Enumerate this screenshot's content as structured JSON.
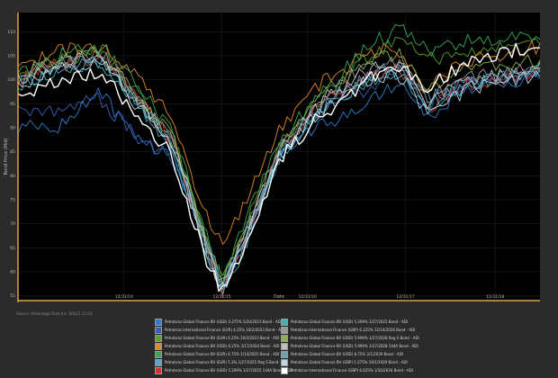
{
  "source": "Source: Advantage Data Inc. 6/4/21 11:53",
  "chart_data": {
    "type": "line",
    "xlabel": "Date",
    "ylabel": "Bond Price (Mid)",
    "x_ticks": [
      "12/31/14",
      "12/31/15",
      "12/31/16",
      "12/31/17",
      "12/31/18"
    ],
    "x_tick_pos": [
      1.3,
      2.5,
      3.55,
      4.75,
      5.85
    ],
    "x_range": [
      0,
      6.4
    ],
    "ylim": [
      54,
      114
    ],
    "y_ticks": [
      55,
      60,
      65,
      70,
      75,
      80,
      85,
      90,
      95,
      100,
      105,
      110
    ],
    "grid": true,
    "legend_placement": "bottom",
    "series": [
      {
        "name": "Petrobras Global Finance BV (USD) 4.375% 5/20/2023 Bond - ADI",
        "color": "#2c7fd0",
        "values": [
          [
            0,
            90
          ],
          [
            0.5,
            90
          ],
          [
            1,
            98
          ],
          [
            1.4,
            88
          ],
          [
            1.9,
            84
          ],
          [
            2.3,
            67
          ],
          [
            2.5,
            57
          ],
          [
            2.8,
            67
          ],
          [
            3.2,
            84
          ],
          [
            3.6,
            90
          ],
          [
            4,
            92
          ],
          [
            4.3,
            96
          ],
          [
            4.7,
            100
          ],
          [
            5,
            92
          ],
          [
            5.5,
            98
          ],
          [
            6.4,
            101
          ]
        ]
      },
      {
        "name": "Petrobras International Finance (EUR) 4.25% 10/2/2023 Bond - ADI",
        "color": "#3a5fb8",
        "values": [
          [
            0,
            93
          ],
          [
            0.5,
            94
          ],
          [
            1,
            96
          ],
          [
            1.4,
            89
          ],
          [
            1.9,
            84
          ],
          [
            2.3,
            68
          ],
          [
            2.5,
            58
          ],
          [
            2.8,
            69
          ],
          [
            3.2,
            85
          ],
          [
            3.6,
            92
          ],
          [
            4,
            95
          ],
          [
            4.3,
            98
          ],
          [
            4.7,
            102
          ],
          [
            5,
            95
          ],
          [
            5.5,
            99
          ],
          [
            6.4,
            102
          ]
        ]
      },
      {
        "name": "Petrobras Global Finance BV (EUR) 4.25% 10/2/2023 Bond - ADI",
        "color": "#5a9f2c",
        "values": [
          [
            0,
            100
          ],
          [
            0.5,
            104
          ],
          [
            1,
            106
          ],
          [
            1.4,
            99
          ],
          [
            1.9,
            88
          ],
          [
            2.3,
            68
          ],
          [
            2.5,
            58
          ],
          [
            2.8,
            70
          ],
          [
            3.2,
            86
          ],
          [
            3.6,
            94
          ],
          [
            4,
            100
          ],
          [
            4.3,
            105
          ],
          [
            4.7,
            108
          ],
          [
            5,
            104
          ],
          [
            5.5,
            106
          ],
          [
            6.4,
            109
          ]
        ]
      },
      {
        "name": "Petrobras Global Finance BV (USD) 6.25% 3/17/2024 Bond - ADI",
        "color": "#e08a1e",
        "values": [
          [
            0,
            102
          ],
          [
            0.5,
            106
          ],
          [
            1,
            107
          ],
          [
            1.4,
            102
          ],
          [
            1.9,
            92
          ],
          [
            2.3,
            72
          ],
          [
            2.5,
            66
          ],
          [
            2.8,
            75
          ],
          [
            3.2,
            90
          ],
          [
            3.6,
            98
          ],
          [
            4,
            102
          ],
          [
            4.3,
            106
          ],
          [
            4.7,
            106
          ],
          [
            5,
            98
          ],
          [
            5.5,
            104
          ],
          [
            6.4,
            107
          ]
        ]
      },
      {
        "name": "Petrobras Global Finance BV (EUR) 4.75% 1/14/2025 Bond - ADI",
        "color": "#37a85a",
        "values": [
          [
            0,
            101
          ],
          [
            0.5,
            105
          ],
          [
            1,
            107
          ],
          [
            1.4,
            100
          ],
          [
            1.9,
            89
          ],
          [
            2.3,
            68
          ],
          [
            2.5,
            58
          ],
          [
            2.8,
            71
          ],
          [
            3.2,
            87
          ],
          [
            3.6,
            95
          ],
          [
            4,
            102
          ],
          [
            4.3,
            107
          ],
          [
            4.7,
            111
          ],
          [
            5,
            106
          ],
          [
            5.5,
            108
          ],
          [
            6.4,
            110
          ]
        ]
      },
      {
        "name": "Petrobras Global Finance BV (EUR) 5.3% 1/27/2025 Reg S Bond - ADI",
        "color": "#5fa0d0",
        "values": [
          [
            0,
            99
          ],
          [
            0.5,
            102
          ],
          [
            1,
            104
          ],
          [
            1.4,
            97
          ],
          [
            1.9,
            87
          ],
          [
            2.3,
            66
          ],
          [
            2.5,
            56
          ],
          [
            2.8,
            67
          ],
          [
            3.2,
            84
          ],
          [
            3.6,
            92
          ],
          [
            4,
            98
          ],
          [
            4.3,
            101
          ],
          [
            4.7,
            103
          ],
          [
            5,
            96
          ],
          [
            5.5,
            99
          ],
          [
            6.4,
            102
          ]
        ]
      },
      {
        "name": "Petrobras Global Finance BV (USD) 5.299% 1/27/2025 144A Bond - ADI",
        "color": "#d83030",
        "values": [
          [
            0,
            100
          ],
          [
            0.5,
            103
          ],
          [
            1,
            105
          ],
          [
            1.4,
            98
          ],
          [
            1.9,
            87
          ],
          [
            2.3,
            66
          ],
          [
            2.5,
            56
          ],
          [
            2.8,
            67
          ],
          [
            3.2,
            85
          ],
          [
            3.6,
            93
          ],
          [
            4,
            98
          ],
          [
            4.3,
            101
          ],
          [
            4.7,
            102
          ],
          [
            5,
            94
          ],
          [
            5.5,
            99
          ],
          [
            6.4,
            102
          ]
        ]
      },
      {
        "name": "Petrobras Global Finance BV (USD) 5.299% 1/27/2025 Bond - ADI",
        "color": "#3ab8b8",
        "values": [
          [
            0,
            99
          ],
          [
            0.5,
            102
          ],
          [
            1,
            104
          ],
          [
            1.4,
            96
          ],
          [
            1.9,
            86
          ],
          [
            2.3,
            65
          ],
          [
            2.5,
            55
          ],
          [
            2.8,
            66
          ],
          [
            3.2,
            84
          ],
          [
            3.6,
            92
          ],
          [
            4,
            97
          ],
          [
            4.3,
            100
          ],
          [
            4.7,
            102
          ],
          [
            5,
            94
          ],
          [
            5.5,
            99
          ],
          [
            6.4,
            102
          ]
        ]
      },
      {
        "name": "Petrobras International Finance (GBP) 6.125% 12/14/2026 Bond - ADI",
        "color": "#9a9a9a",
        "values": [
          [
            0,
            102
          ],
          [
            0.5,
            104
          ],
          [
            1,
            106
          ],
          [
            1.4,
            98
          ],
          [
            1.9,
            87
          ],
          [
            2.3,
            66
          ],
          [
            2.5,
            57
          ],
          [
            2.8,
            68
          ],
          [
            3.2,
            86
          ],
          [
            3.6,
            94
          ],
          [
            4,
            100
          ],
          [
            4.3,
            103
          ],
          [
            4.7,
            104
          ],
          [
            5,
            96
          ],
          [
            5.5,
            100
          ],
          [
            6.4,
            103
          ]
        ]
      },
      {
        "name": "Petrobras Global Finance BV (USD) 5.999% 1/27/2028 Reg S Bond - ADI",
        "color": "#8ab04a",
        "values": [
          [
            0,
            101
          ],
          [
            0.5,
            104
          ],
          [
            1,
            106
          ],
          [
            1.4,
            98
          ],
          [
            1.9,
            88
          ],
          [
            2.3,
            67
          ],
          [
            2.5,
            58
          ],
          [
            2.8,
            69
          ],
          [
            3.2,
            86
          ],
          [
            3.6,
            94
          ],
          [
            4,
            101
          ],
          [
            4.3,
            104
          ],
          [
            4.7,
            105
          ],
          [
            5,
            98
          ],
          [
            5.5,
            102
          ],
          [
            6.4,
            104
          ]
        ]
      },
      {
        "name": "Petrobras Global Finance BV (USD) 5.999% 1/27/2028 144A Bond - ADI",
        "color": "#c0c0c0",
        "values": [
          [
            0,
            100
          ],
          [
            0.5,
            103
          ],
          [
            1,
            105
          ],
          [
            1.4,
            97
          ],
          [
            1.9,
            87
          ],
          [
            2.3,
            66
          ],
          [
            2.5,
            57
          ],
          [
            2.8,
            68
          ],
          [
            3.2,
            85
          ],
          [
            3.6,
            93
          ],
          [
            4,
            99
          ],
          [
            4.3,
            102
          ],
          [
            4.7,
            103
          ],
          [
            5,
            95
          ],
          [
            5.5,
            100
          ],
          [
            6.4,
            102
          ]
        ]
      },
      {
        "name": "Petrobras Global Finance BV (USD) 8.75% 2/1/2029 Bond - ADI",
        "color": "#6aa0b8",
        "values": [
          [
            0,
            100
          ],
          [
            0.5,
            103
          ],
          [
            1,
            105
          ],
          [
            1.4,
            97
          ],
          [
            1.9,
            86
          ],
          [
            2.3,
            65
          ],
          [
            2.5,
            56
          ],
          [
            2.8,
            67
          ],
          [
            3.2,
            85
          ],
          [
            3.6,
            92
          ],
          [
            4,
            98
          ],
          [
            4.3,
            101
          ],
          [
            4.7,
            102
          ],
          [
            5,
            94
          ],
          [
            5.5,
            99
          ],
          [
            6.4,
            102
          ]
        ]
      },
      {
        "name": "Petrobras Global Finance BV (GBP) 5.375% 10/1/2029 Bond - ADI",
        "color": "#b8d8e8",
        "values": [
          [
            0,
            99
          ],
          [
            0.5,
            102
          ],
          [
            1,
            104
          ],
          [
            1.4,
            96
          ],
          [
            1.9,
            86
          ],
          [
            2.3,
            65
          ],
          [
            2.5,
            56
          ],
          [
            2.8,
            67
          ],
          [
            3.2,
            84
          ],
          [
            3.6,
            92
          ],
          [
            4,
            97
          ],
          [
            4.3,
            100
          ],
          [
            4.7,
            101
          ],
          [
            5,
            93
          ],
          [
            5.5,
            98
          ],
          [
            6.4,
            101
          ]
        ]
      },
      {
        "name": "Petrobras International Finance (GBP) 6.625% 1/16/2034 Bond - ADI",
        "color": "#ffffff",
        "values": [
          [
            0,
            97
          ],
          [
            0.5,
            100
          ],
          [
            1,
            102
          ],
          [
            1.4,
            94
          ],
          [
            1.9,
            84
          ],
          [
            2.3,
            63
          ],
          [
            2.5,
            56
          ],
          [
            2.8,
            66
          ],
          [
            3.2,
            83
          ],
          [
            3.6,
            91
          ],
          [
            4,
            96
          ],
          [
            4.3,
            100
          ],
          [
            4.7,
            103
          ],
          [
            5,
            98
          ],
          [
            5.5,
            104
          ],
          [
            6.4,
            107
          ]
        ]
      }
    ]
  }
}
